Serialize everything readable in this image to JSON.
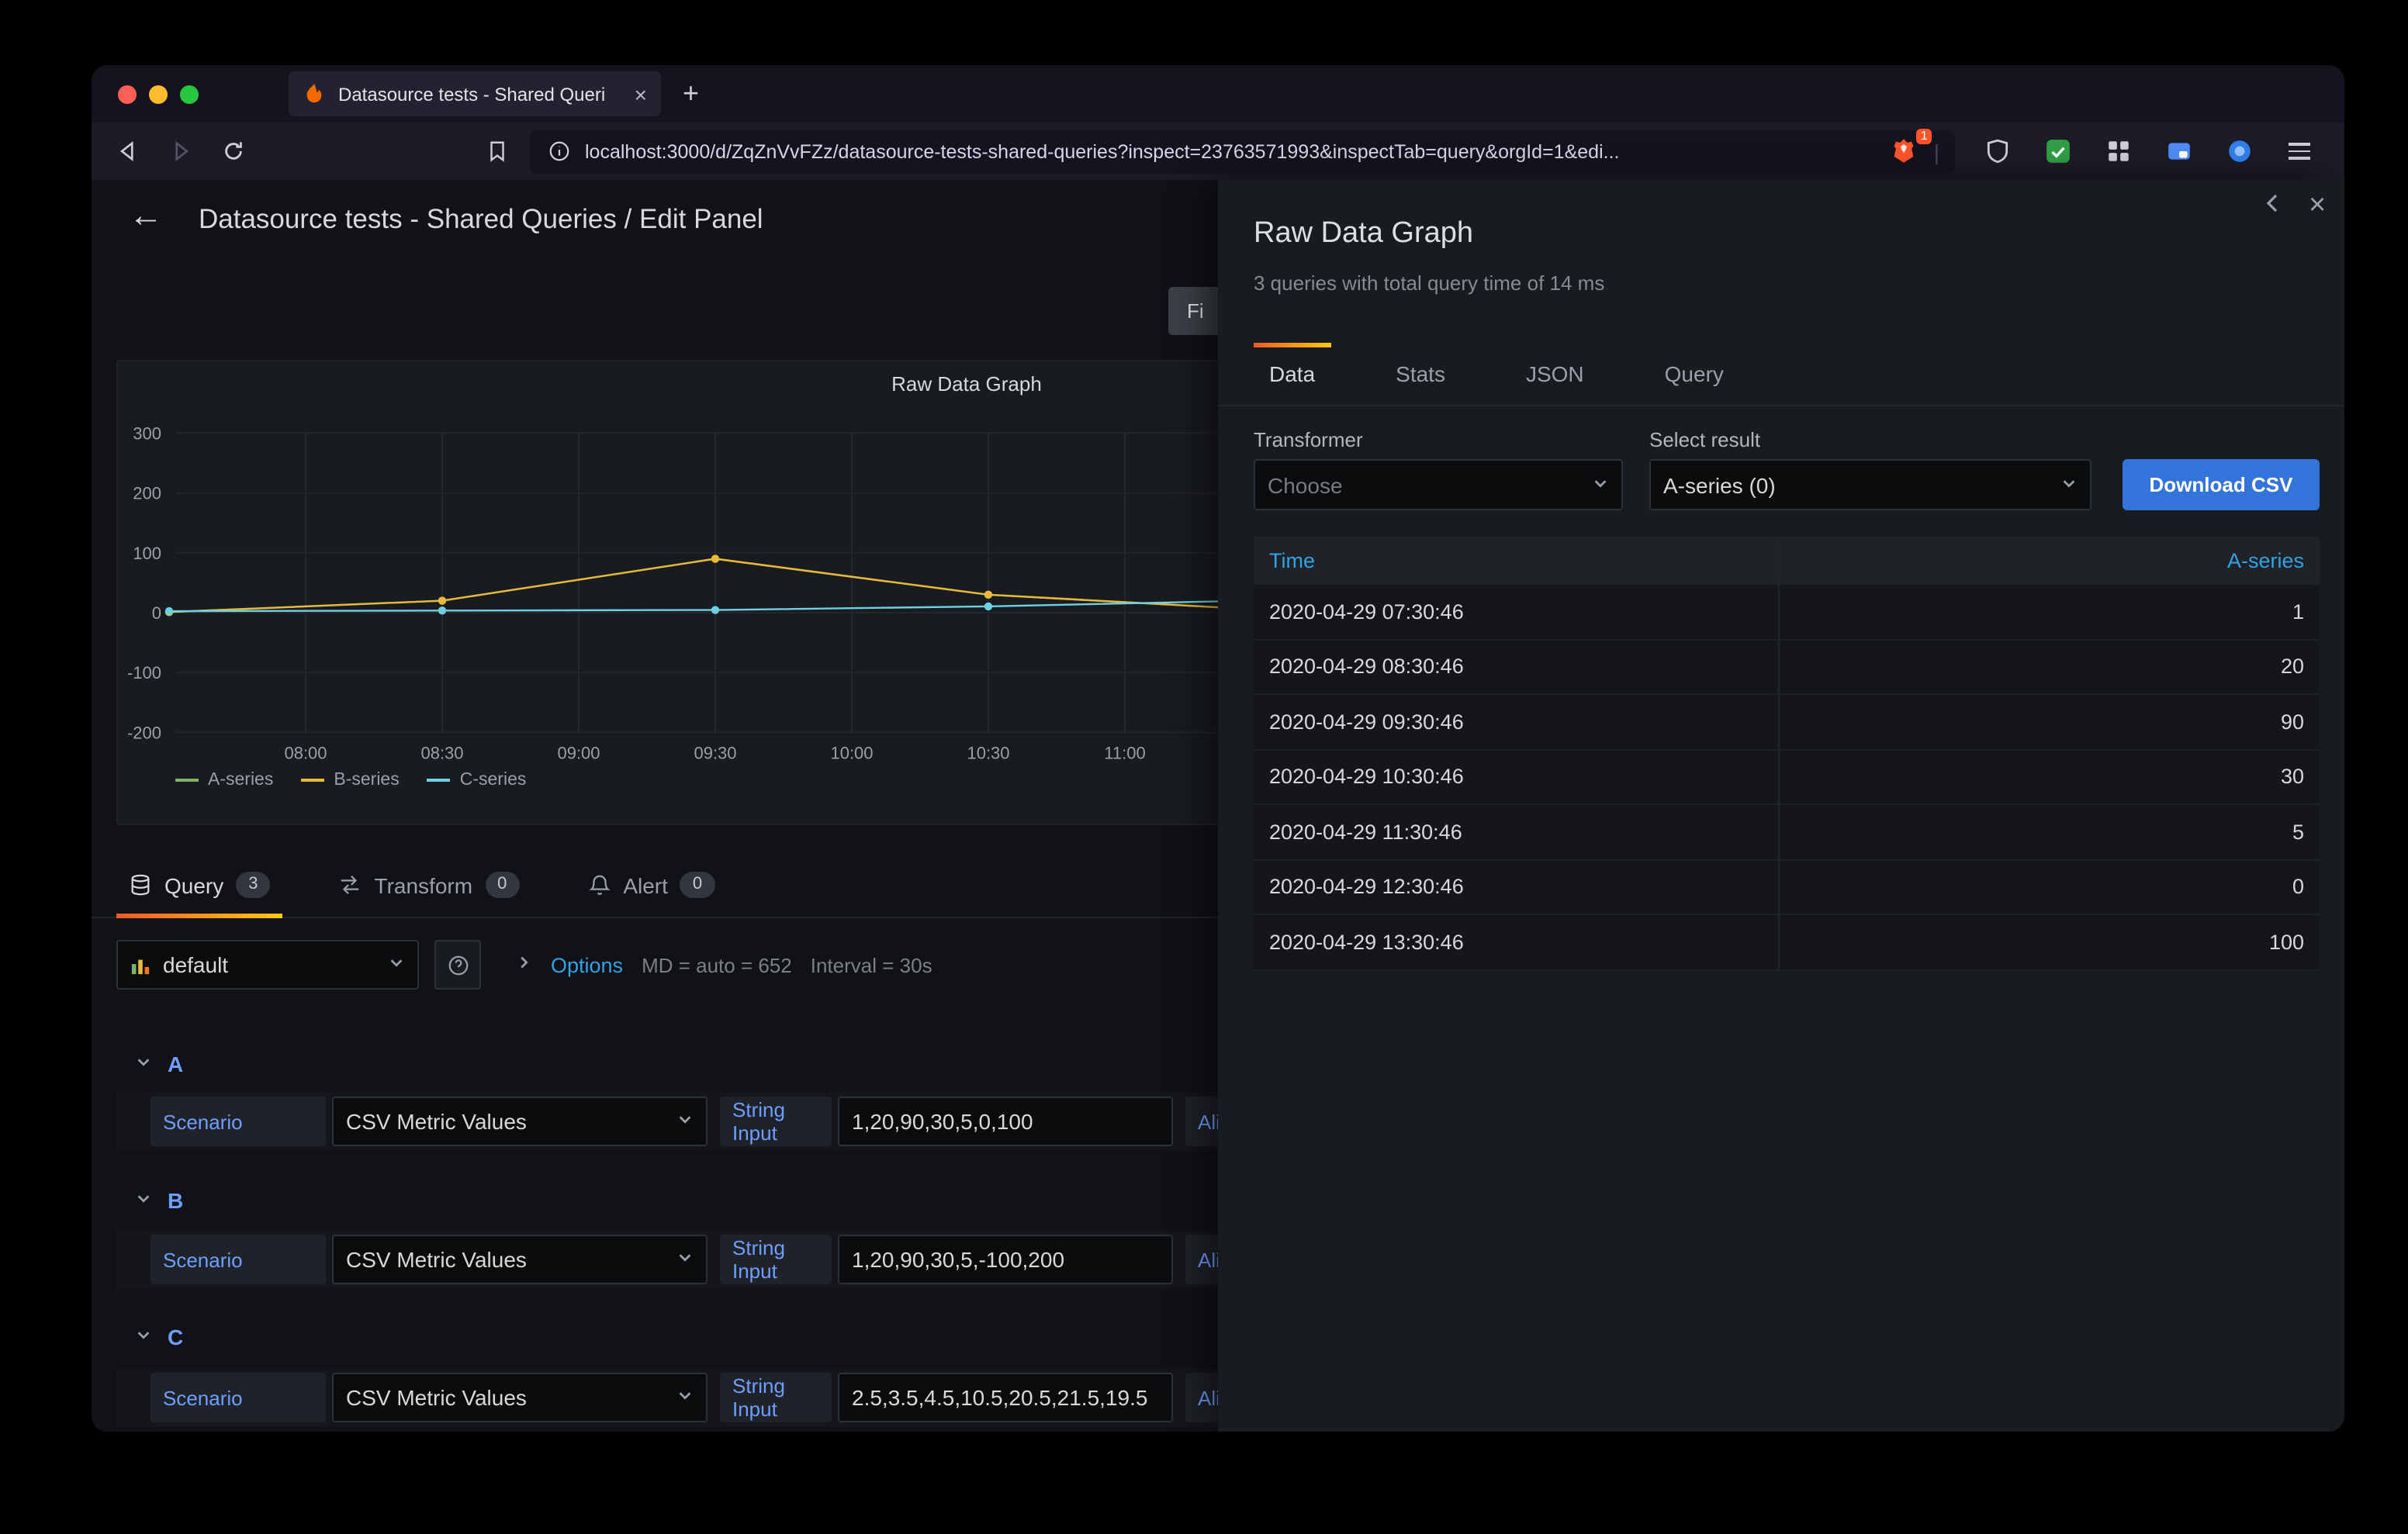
{
  "colors": {
    "accent_orange": "#f05a28",
    "accent_yellow": "#fbca0a",
    "link_blue": "#33a2e5",
    "label_blue": "#6e9fff",
    "primary_button_blue": "#3274d9"
  },
  "browser": {
    "tab_title": "Datasource tests - Shared Queri",
    "url": "localhost:3000/d/ZqZnVvFZz/datasource-tests-shared-queries?inspect=23763571993&inspectTab=query&orgId=1&edi...",
    "shield_badge": "1",
    "new_tab_label": "+",
    "tab_close_label": "×"
  },
  "page": {
    "back_arrow": "←",
    "title": "Datasource tests - Shared Queries / Edit Panel",
    "clipped_button_label": "Fi"
  },
  "panel": {
    "title": "Raw Data Graph"
  },
  "chart_data": {
    "type": "line",
    "title": "Raw Data Graph",
    "x": [
      "07:30",
      "08:30",
      "09:30",
      "10:30",
      "11:30",
      "12:30",
      "13:30"
    ],
    "series": [
      {
        "name": "A-series",
        "color": "#7EB26D",
        "values": [
          1,
          20,
          90,
          30,
          5,
          0,
          100
        ]
      },
      {
        "name": "B-series",
        "color": "#EAB839",
        "values": [
          1,
          20,
          90,
          30,
          5,
          -100,
          200
        ]
      },
      {
        "name": "C-series",
        "color": "#6ED0E0",
        "values": [
          2.5,
          3.5,
          4.5,
          10.5,
          20.5,
          21.5,
          19.5
        ]
      }
    ],
    "y_ticks": [
      300,
      200,
      100,
      0,
      -100,
      -200
    ],
    "x_ticks": [
      "08:00",
      "08:30",
      "09:00",
      "09:30",
      "10:00",
      "10:30",
      "11:00"
    ],
    "ylim": [
      -250,
      350
    ],
    "grid": true,
    "legend_position": "bottom"
  },
  "editor_tabs": [
    {
      "label": "Query",
      "count": "3",
      "active": true
    },
    {
      "label": "Transform",
      "count": "0",
      "active": false
    },
    {
      "label": "Alert",
      "count": "0",
      "active": false
    }
  ],
  "query_toolbar": {
    "datasource": "default",
    "options_label": "Options",
    "options_meta_1": "MD = auto = 652",
    "options_meta_2": "Interval = 30s"
  },
  "queries": [
    {
      "ref": "A",
      "scenario_label": "Scenario",
      "scenario_value": "CSV Metric Values",
      "input_label": "String Input",
      "input_value": "1,20,90,30,5,0,100",
      "alias_label_clipped": "Ali"
    },
    {
      "ref": "B",
      "scenario_label": "Scenario",
      "scenario_value": "CSV Metric Values",
      "input_label": "String Input",
      "input_value": "1,20,90,30,5,-100,200",
      "alias_label_clipped": "Ali"
    },
    {
      "ref": "C",
      "scenario_label": "Scenario",
      "scenario_value": "CSV Metric Values",
      "input_label": "String Input",
      "input_value": "2.5,3.5,4.5,10.5,20.5,21.5,19.5",
      "alias_label_clipped": "Ali"
    }
  ],
  "drawer": {
    "title": "Raw Data Graph",
    "subtitle": "3 queries with total query time of 14 ms",
    "close_label": "×",
    "tabs": [
      {
        "label": "Data",
        "active": true
      },
      {
        "label": "Stats",
        "active": false
      },
      {
        "label": "JSON",
        "active": false
      },
      {
        "label": "Query",
        "active": false
      }
    ],
    "transformer_label": "Transformer",
    "transformer_placeholder": "Choose",
    "select_result_label": "Select result",
    "select_result_value": "A-series (0)",
    "download_button": "Download CSV",
    "table": {
      "columns": [
        "Time",
        "A-series"
      ],
      "rows": [
        [
          "2020-04-29 07:30:46",
          "1"
        ],
        [
          "2020-04-29 08:30:46",
          "20"
        ],
        [
          "2020-04-29 09:30:46",
          "90"
        ],
        [
          "2020-04-29 10:30:46",
          "30"
        ],
        [
          "2020-04-29 11:30:46",
          "5"
        ],
        [
          "2020-04-29 12:30:46",
          "0"
        ],
        [
          "2020-04-29 13:30:46",
          "100"
        ]
      ]
    }
  }
}
